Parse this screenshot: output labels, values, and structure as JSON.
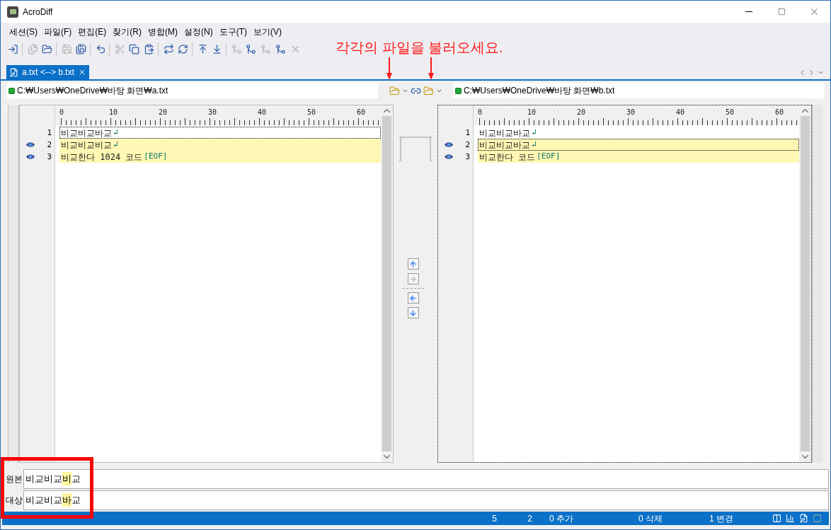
{
  "window": {
    "title": "AcroDiff"
  },
  "menu": [
    "세션(S)",
    "파일(F)",
    "편집(E)",
    "찾기(R)",
    "병합(M)",
    "설정(N)",
    "도구(T)",
    "보기(V)"
  ],
  "toolbar": [
    {
      "kind": "session",
      "disabled": false,
      "group_start": false
    },
    {
      "kind": "new",
      "disabled": true,
      "group_start": true
    },
    {
      "kind": "open",
      "disabled": false,
      "group_start": false
    },
    {
      "kind": "save",
      "disabled": true,
      "group_start": true
    },
    {
      "kind": "saveall",
      "disabled": false,
      "group_start": false
    },
    {
      "kind": "undo",
      "disabled": false,
      "group_start": true
    },
    {
      "kind": "cut",
      "disabled": true,
      "group_start": true
    },
    {
      "kind": "copy",
      "disabled": false,
      "group_start": false
    },
    {
      "kind": "paste",
      "disabled": false,
      "group_start": false
    },
    {
      "kind": "swap",
      "disabled": false,
      "group_start": true
    },
    {
      "kind": "refresh",
      "disabled": false,
      "group_start": false
    },
    {
      "kind": "up",
      "disabled": false,
      "group_start": true
    },
    {
      "kind": "down",
      "disabled": false,
      "group_start": false
    },
    {
      "kind": "merge",
      "disabled": true,
      "group_start": true
    },
    {
      "kind": "merge",
      "disabled": false,
      "group_start": false
    },
    {
      "kind": "merge",
      "disabled": true,
      "group_start": false
    },
    {
      "kind": "merge",
      "disabled": false,
      "group_start": false
    },
    {
      "kind": "close",
      "disabled": true,
      "group_start": false
    }
  ],
  "annotation": "각각의 파일을 불러오세요.",
  "tabs": [
    {
      "label": "a.txt <--> b.txt",
      "selected": true
    }
  ],
  "left_path": "C:₩Users₩OneDrive₩바탕 화면₩a.txt",
  "right_path": "C:₩Users₩OneDrive₩바탕 화면₩b.txt",
  "left_pane": {
    "focused": false,
    "ruler": [
      "0",
      "10",
      "20",
      "30",
      "40",
      "50",
      "60"
    ],
    "lines": [
      {
        "number": "1",
        "text": "비교비교바교",
        "end": "↲",
        "changed": false,
        "current": true
      },
      {
        "number": "2",
        "text": "비교비교비교",
        "end": "↲",
        "changed": true,
        "current": false
      },
      {
        "number": "3",
        "text": "비교한다 1024 코드",
        "end": "[EOF]",
        "changed": true,
        "current": false
      }
    ]
  },
  "right_pane": {
    "focused": true,
    "ruler": [
      "0",
      "10",
      "20",
      "30",
      "40",
      "50",
      "60"
    ],
    "lines": [
      {
        "number": "1",
        "text": "비교비교바교",
        "end": "↲",
        "changed": false,
        "current": false
      },
      {
        "number": "2",
        "text": "비교비교바교",
        "end": "↲",
        "changed": true,
        "current": true
      },
      {
        "number": "3",
        "text": "비교한다 코드",
        "end": "[EOF]",
        "changed": true,
        "current": false
      }
    ]
  },
  "nav_buttons": [
    {
      "kind": "up",
      "disabled": false
    },
    {
      "kind": "right",
      "disabled": true
    },
    {
      "kind": "left",
      "disabled": false
    },
    {
      "kind": "down",
      "disabled": false
    }
  ],
  "compare": [
    {
      "label": "원본",
      "segments": [
        {
          "text": "비교비교",
          "highlight": false
        },
        {
          "text": "비",
          "highlight": true
        },
        {
          "text": "교",
          "highlight": false
        }
      ]
    },
    {
      "label": "대상",
      "segments": [
        {
          "text": "비교비교",
          "highlight": false
        },
        {
          "text": "바",
          "highlight": true
        },
        {
          "text": "교",
          "highlight": false
        }
      ]
    }
  ],
  "status_bar": [
    "5",
    "2",
    "0 추가",
    "0 삭제",
    "1 변경"
  ]
}
